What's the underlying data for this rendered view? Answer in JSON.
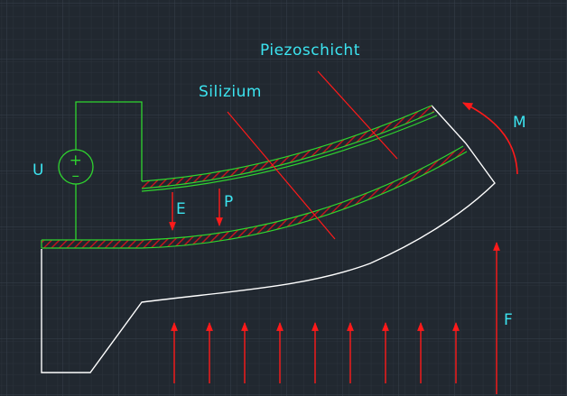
{
  "labels": {
    "piezo_layer": "Piezoschicht",
    "silicon": "Silizium",
    "voltage": "U",
    "plus_sign": "+",
    "minus_sign": "–",
    "electric_field": "E",
    "polarization": "P",
    "moment": "M",
    "force": "F"
  },
  "colors": {
    "background": "#212830",
    "grid_minor": "#2b323c",
    "grid_major": "#36404b",
    "outline": "#ffffff",
    "conductor": "#2fd52f",
    "annotation": "#ff1a1a",
    "text": "#3ce4f0"
  }
}
